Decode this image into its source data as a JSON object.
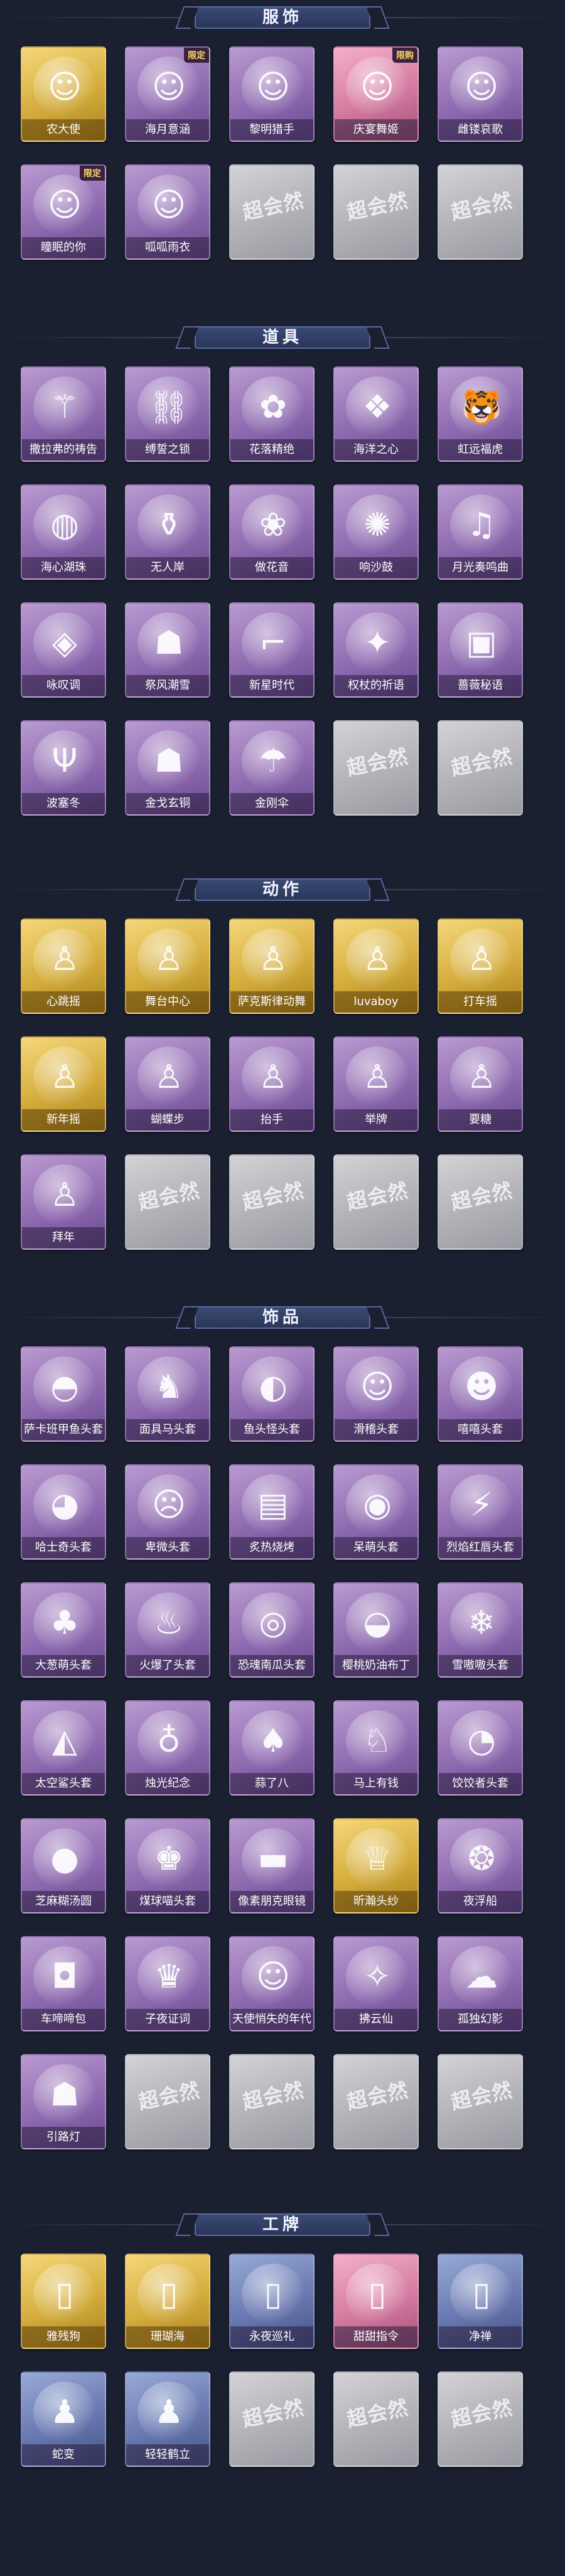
{
  "brand_watermark": "超会然",
  "colors": {
    "background": "#1a2030",
    "header": "#2a365a",
    "accent": "#5b6aa0"
  },
  "sections": [
    {
      "title": "服饰",
      "items": [
        {
          "label": "农大使",
          "tier": "gold",
          "icon": "portrait-icon",
          "tag": ""
        },
        {
          "label": "海月意涵",
          "tier": "purple",
          "icon": "portrait-icon",
          "tag": "限定"
        },
        {
          "label": "黎明猎手",
          "tier": "purple",
          "icon": "portrait-icon",
          "tag": ""
        },
        {
          "label": "庆宴舞姬",
          "tier": "pink",
          "icon": "portrait-icon",
          "tag": "限购"
        },
        {
          "label": "雌镂哀歌",
          "tier": "purple",
          "icon": "portrait-icon",
          "tag": ""
        },
        {
          "label": "瞳眠的你",
          "tier": "purple",
          "icon": "portrait-icon",
          "tag": "限定"
        },
        {
          "label": "呱呱雨衣",
          "tier": "purple",
          "icon": "portrait-icon",
          "tag": ""
        },
        {
          "label": "",
          "tier": "empty"
        },
        {
          "label": "",
          "tier": "empty"
        },
        {
          "label": "",
          "tier": "empty"
        }
      ]
    },
    {
      "title": "道具",
      "items": [
        {
          "label": "撒拉弗的祷告",
          "tier": "purple",
          "icon": "scepter-icon"
        },
        {
          "label": "缚誓之锁",
          "tier": "purple",
          "icon": "chain-icon"
        },
        {
          "label": "花落精绝",
          "tier": "purple",
          "icon": "flower-icon"
        },
        {
          "label": "海洋之心",
          "tier": "purple",
          "icon": "pendant-icon"
        },
        {
          "label": "虹远福虎",
          "tier": "purple",
          "icon": "tiger-icon"
        },
        {
          "label": "海心湖珠",
          "tier": "purple",
          "icon": "pearl-icon"
        },
        {
          "label": "无人岸",
          "tier": "purple",
          "icon": "bottle-icon"
        },
        {
          "label": "做花音",
          "tier": "purple",
          "icon": "garland-icon"
        },
        {
          "label": "响沙鼓",
          "tier": "purple",
          "icon": "dreamcatcher-icon"
        },
        {
          "label": "月光奏鸣曲",
          "tier": "purple",
          "icon": "musicbox-icon"
        },
        {
          "label": "咏叹调",
          "tier": "purple",
          "icon": "mirror-icon"
        },
        {
          "label": "祭风潮雪",
          "tier": "purple",
          "icon": "lantern-icon"
        },
        {
          "label": "新星时代",
          "tier": "purple",
          "icon": "revolver-icon"
        },
        {
          "label": "权杖的祈语",
          "tier": "purple",
          "icon": "wand-icon"
        },
        {
          "label": "蔷薇秘语",
          "tier": "purple",
          "icon": "case-icon"
        },
        {
          "label": "波塞冬",
          "tier": "purple",
          "icon": "trident-icon"
        },
        {
          "label": "金戈玄铜",
          "tier": "purple",
          "icon": "lantern-icon"
        },
        {
          "label": "金刚伞",
          "tier": "purple",
          "icon": "umbrella-icon"
        },
        {
          "label": "",
          "tier": "empty"
        },
        {
          "label": "",
          "tier": "empty"
        }
      ]
    },
    {
      "title": "动作",
      "items": [
        {
          "label": "心跳摇",
          "tier": "gold",
          "icon": "figure-icon"
        },
        {
          "label": "舞台中心",
          "tier": "gold",
          "icon": "figure-icon"
        },
        {
          "label": "萨克斯律动舞",
          "tier": "gold",
          "icon": "figure-icon"
        },
        {
          "label": "luvaboy",
          "tier": "gold",
          "icon": "figure-icon"
        },
        {
          "label": "打车摇",
          "tier": "gold",
          "icon": "figure-icon"
        },
        {
          "label": "新年摇",
          "tier": "gold",
          "icon": "figure-icon"
        },
        {
          "label": "蝴蝶步",
          "tier": "purple",
          "icon": "figure-icon"
        },
        {
          "label": "抬手",
          "tier": "purple",
          "icon": "figure-icon"
        },
        {
          "label": "举牌",
          "tier": "purple",
          "icon": "figure-icon"
        },
        {
          "label": "要糖",
          "tier": "purple",
          "icon": "figure-icon"
        },
        {
          "label": "拜年",
          "tier": "purple",
          "icon": "figure-icon"
        },
        {
          "label": "",
          "tier": "empty"
        },
        {
          "label": "",
          "tier": "empty"
        },
        {
          "label": "",
          "tier": "empty"
        },
        {
          "label": "",
          "tier": "empty"
        }
      ]
    },
    {
      "title": "饰品",
      "items": [
        {
          "label": "萨卡班甲鱼头套",
          "tier": "purple",
          "icon": "fish-icon"
        },
        {
          "label": "面具马头套",
          "tier": "purple",
          "icon": "horse-icon"
        },
        {
          "label": "鱼头怪头套",
          "tier": "purple",
          "icon": "fishhead-icon"
        },
        {
          "label": "滑稽头套",
          "tier": "purple",
          "icon": "smiley-icon"
        },
        {
          "label": "嘻嘻头套",
          "tier": "purple",
          "icon": "grin-icon"
        },
        {
          "label": "哈士奇头套",
          "tier": "purple",
          "icon": "dog-icon"
        },
        {
          "label": "卑微头套",
          "tier": "purple",
          "icon": "sad-icon"
        },
        {
          "label": "炙热烧烤",
          "tier": "purple",
          "icon": "toast-icon"
        },
        {
          "label": "呆萌头套",
          "tier": "purple",
          "icon": "stare-icon"
        },
        {
          "label": "烈焰红唇头套",
          "tier": "purple",
          "icon": "pikachu-icon"
        },
        {
          "label": "大葱萌头套",
          "tier": "purple",
          "icon": "leek-icon"
        },
        {
          "label": "火爆了头套",
          "tier": "purple",
          "icon": "flame-icon"
        },
        {
          "label": "恐魂南瓜头套",
          "tier": "purple",
          "icon": "pumpkin-icon"
        },
        {
          "label": "樱桃奶油布丁",
          "tier": "purple",
          "icon": "pudding-icon"
        },
        {
          "label": "雪嗷嗷头套",
          "tier": "purple",
          "icon": "snowball-icon"
        },
        {
          "label": "太空鲨头套",
          "tier": "purple",
          "icon": "shark-icon"
        },
        {
          "label": "烛光纪念",
          "tier": "purple",
          "icon": "candle-icon"
        },
        {
          "label": "蒜了八",
          "tier": "purple",
          "icon": "garlic-icon"
        },
        {
          "label": "马上有钱",
          "tier": "purple",
          "icon": "horsehead-icon"
        },
        {
          "label": "饺饺者头套",
          "tier": "purple",
          "icon": "dumpling-icon"
        },
        {
          "label": "芝麻糊汤圆",
          "tier": "purple",
          "icon": "ball-icon"
        },
        {
          "label": "煤球喵头套",
          "tier": "purple",
          "icon": "cat-icon"
        },
        {
          "label": "像素朋克眼镜",
          "tier": "purple",
          "icon": "glasses-icon"
        },
        {
          "label": "昕瀚头纱",
          "tier": "gold",
          "icon": "veil-icon"
        },
        {
          "label": "夜浮船",
          "tier": "purple",
          "icon": "shell-icon"
        },
        {
          "label": "车啼啼包",
          "tier": "purple",
          "icon": "bag-icon"
        },
        {
          "label": "子夜证词",
          "tier": "purple",
          "icon": "owl-icon"
        },
        {
          "label": "天使悄失的年代",
          "tier": "purple",
          "icon": "portrait-icon"
        },
        {
          "label": "拂云仙",
          "tier": "purple",
          "icon": "ornament-icon"
        },
        {
          "label": "孤独幻影",
          "tier": "purple",
          "icon": "spirit-icon"
        },
        {
          "label": "引路灯",
          "tier": "purple",
          "icon": "lantern-icon"
        },
        {
          "label": "",
          "tier": "empty"
        },
        {
          "label": "",
          "tier": "empty"
        },
        {
          "label": "",
          "tier": "empty"
        },
        {
          "label": "",
          "tier": "empty"
        }
      ]
    },
    {
      "title": "工牌",
      "items": [
        {
          "label": "雅残狗",
          "tier": "gold",
          "icon": "card-icon"
        },
        {
          "label": "珊瑚海",
          "tier": "gold",
          "icon": "card-icon"
        },
        {
          "label": "永夜巡礼",
          "tier": "blue",
          "icon": "card-icon"
        },
        {
          "label": "甜甜指令",
          "tier": "pink",
          "icon": "card-icon"
        },
        {
          "label": "净禅",
          "tier": "blue",
          "icon": "card-icon"
        },
        {
          "label": "蛇变",
          "tier": "blue",
          "icon": "silhouette-icon"
        },
        {
          "label": "轻轻鹤立",
          "tier": "blue",
          "icon": "silhouette-icon"
        },
        {
          "label": "",
          "tier": "empty"
        },
        {
          "label": "",
          "tier": "empty"
        },
        {
          "label": "",
          "tier": "empty"
        }
      ]
    }
  ]
}
